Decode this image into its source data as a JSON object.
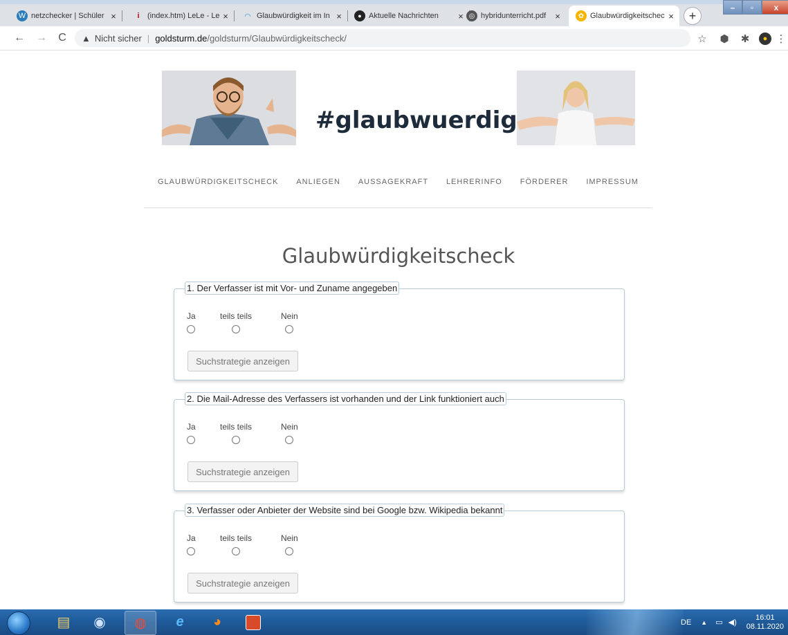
{
  "browser": {
    "tabs": [
      {
        "title": "netzchecker | Schüler",
        "icon": "wordpress-icon"
      },
      {
        "title": "(index.htm) LeLe - Leh",
        "icon": "info-icon"
      },
      {
        "title": "Glaubwürdigkeit im In",
        "icon": "wifi-icon"
      },
      {
        "title": "Aktuelle Nachrichten",
        "icon": "news-icon"
      },
      {
        "title": "hybridunterricht.pdf",
        "icon": "globe-icon"
      },
      {
        "title": "Glaubwürdigkeitschec",
        "icon": "site-icon",
        "active": true
      }
    ],
    "address": {
      "security_label": "Nicht sicher",
      "host": "goldsturm.de",
      "path": "/goldsturm/Glaubwürdigkeitscheck/"
    }
  },
  "site": {
    "banner_title": "#glaubwuerdigkeit",
    "nav": [
      "GLAUBWÜRDIGKEITSCHECK",
      "ANLIEGEN",
      "AUSSAGEKRAFT",
      "LEHRERINFO",
      "FÖRDERER",
      "IMPRESSUM"
    ],
    "page_title": "Glaubwürdigkeitscheck"
  },
  "questions": [
    {
      "title": "1. Der Verfasser ist mit Vor- und Zuname angegeben",
      "options": [
        "Ja",
        "teils teils",
        "Nein"
      ],
      "button": "Suchstrategie anzeigen"
    },
    {
      "title": "2. Die Mail-Adresse des Verfassers ist vorhanden und der Link funktioniert auch",
      "options": [
        "Ja",
        "teils teils",
        "Nein"
      ],
      "button": "Suchstrategie anzeigen"
    },
    {
      "title": "3. Verfasser oder Anbieter der Website sind bei Google bzw. Wikipedia bekannt",
      "options": [
        "Ja",
        "teils teils",
        "Nein"
      ],
      "button": "Suchstrategie anzeigen"
    }
  ],
  "taskbar": {
    "language": "DE",
    "time": "16:01",
    "date": "08.11.2020"
  },
  "colors": {
    "card_border": "#b5cbd8",
    "banner_text": "#1e2b3a",
    "taskbar": "#1f5a98"
  }
}
